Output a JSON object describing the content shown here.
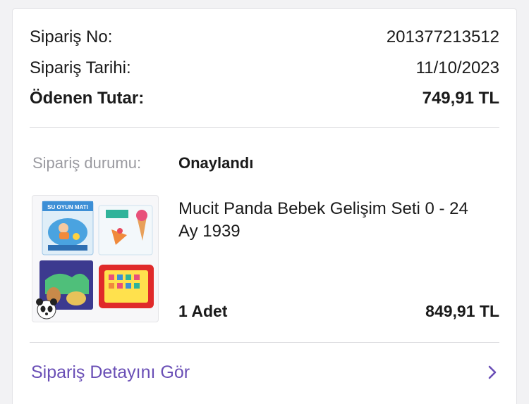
{
  "order": {
    "number_label": "Sipariş No:",
    "number_value": "201377213512",
    "date_label": "Sipariş Tarihi:",
    "date_value": "11/10/2023",
    "paid_label": "Ödenen Tutar:",
    "paid_value": "749,91 TL"
  },
  "status": {
    "label": "Sipariş durumu:",
    "value": "Onaylandı"
  },
  "product": {
    "name": "Mucit Panda Bebek Gelişim Seti 0 - 24 Ay 1939",
    "quantity": "1 Adet",
    "price": "849,91 TL",
    "thumbnail_text": "SU OYUN MATI"
  },
  "detail_link": {
    "label": "Sipariş Detayını Gör",
    "icon": "chevron-right-icon"
  },
  "colors": {
    "accent": "#6a4fb6",
    "muted": "#9a9aa0",
    "text": "#1a1a1a"
  }
}
